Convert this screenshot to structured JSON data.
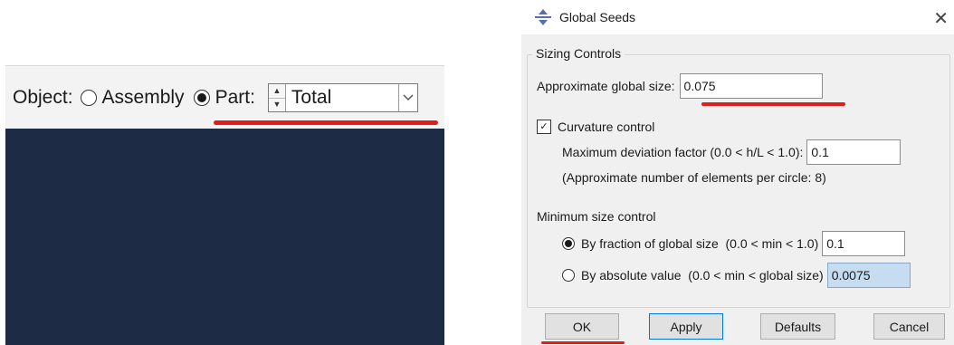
{
  "toolbar": {
    "object_label": "Object:",
    "options": [
      {
        "label": "Assembly",
        "selected": false
      },
      {
        "label": "Part:",
        "selected": true
      }
    ],
    "combo_value": "Total"
  },
  "dialog": {
    "title": "Global Seeds",
    "group_title": "Sizing Controls",
    "approx_label": "Approximate global size:",
    "approx_value": "0.075",
    "curvature_label": "Curvature control",
    "curvature_checked": true,
    "max_dev_label": "Maximum deviation factor (0.0 < h/L < 1.0):",
    "max_dev_value": "0.1",
    "approx_elements": "(Approximate number of elements per circle: 8)",
    "min_size_label": "Minimum size control",
    "by_fraction_label": "By fraction of global size  (0.0 < min < 1.0)",
    "by_fraction_value": "0.1",
    "by_fraction_selected": true,
    "by_absolute_label": "By absolute value  (0.0 < min < global size)",
    "by_absolute_value": "0.0075",
    "buttons": {
      "ok": "OK",
      "apply": "Apply",
      "defaults": "Defaults",
      "cancel": "Cancel"
    }
  },
  "colors": {
    "viewport": "#1d2b45",
    "highlight_underline": "#e11d1d",
    "selected_field": "#c6dcf0"
  },
  "icons": {
    "title": "global-seeds-icon",
    "close": "close-icon"
  }
}
